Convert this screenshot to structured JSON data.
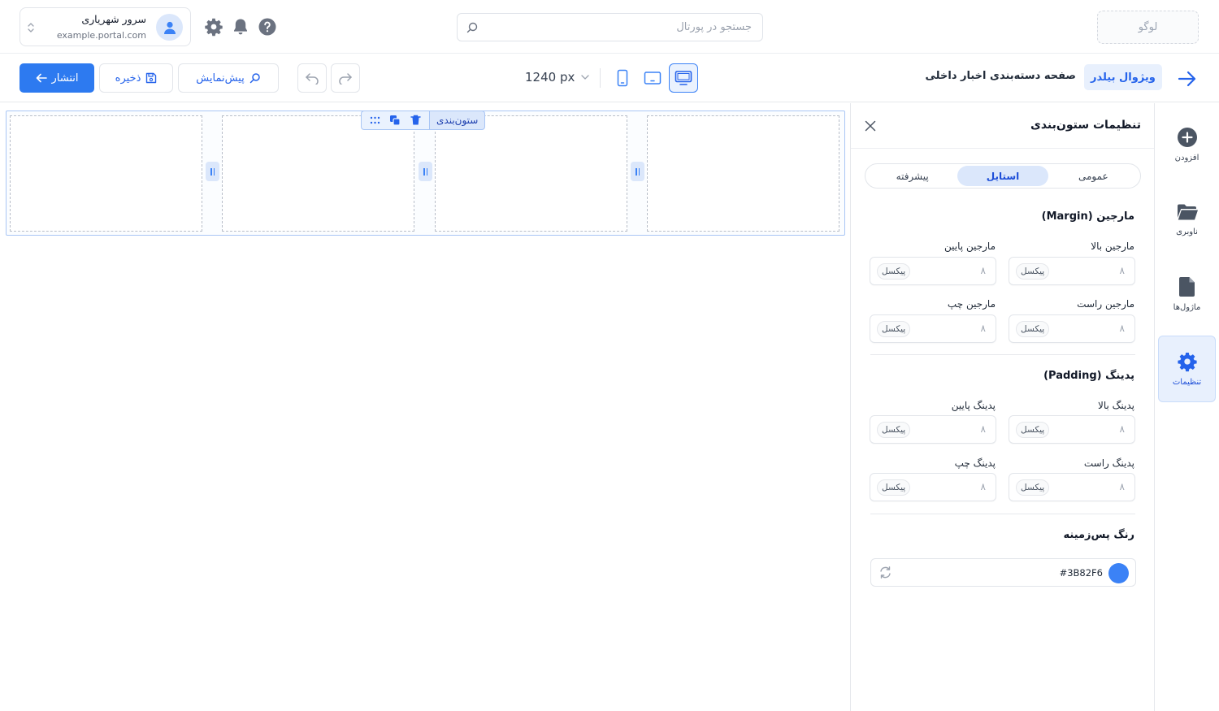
{
  "header": {
    "logo_text": "لوگو",
    "search_placeholder": "جستجو در پورتال",
    "user": {
      "name": "سرور شهریاری",
      "url": "example.portal.com"
    },
    "icons": [
      "help-icon",
      "bell-icon",
      "gear-icon"
    ]
  },
  "toolbar": {
    "crumb_app": "ویژوال بیلدر",
    "page_title": "صفحه دسته‌بندی اخبار داخلی",
    "width_value": "1240 px",
    "active_device": "desktop",
    "devices": [
      "desktop",
      "tablet",
      "mobile"
    ],
    "preview_label": "پیش‌نمایش",
    "save_label": "ذخیره",
    "publish_label": "انتشار"
  },
  "canvas": {
    "row_label": "ستون‌بندی",
    "columns_count_visible": 4
  },
  "panel": {
    "title": "تنظیمات ستون‌بندی",
    "tabs": [
      {
        "label": "عمومی",
        "active": false
      },
      {
        "label": "استایل",
        "active": true
      },
      {
        "label": "پیشرفته",
        "active": false
      }
    ],
    "margin": {
      "title": "مارجین (Margin)",
      "top_label": "مارجین بالا",
      "bottom_label": "مارجین پایین",
      "right_label": "مارجین راست",
      "left_label": "مارجین چپ",
      "top_value": "۸",
      "bottom_value": "۸",
      "right_value": "۸",
      "left_value": "۸"
    },
    "padding": {
      "title": "پدینگ (Padding)",
      "top_label": "پدینگ بالا",
      "bottom_label": "پدینگ پایین",
      "right_label": "پدینگ راست",
      "left_label": "پدینگ چپ",
      "top_value": "۸",
      "bottom_value": "۸",
      "right_value": "۸",
      "left_value": "۸"
    },
    "unit_label": "پیکسل",
    "background": {
      "title": "رنگ پس‌زمینه",
      "hex": "#3B82F6",
      "color": "#3B82F6"
    }
  },
  "rail": {
    "items": [
      {
        "label": "افزودن",
        "icon": "plus-circle-icon",
        "active": false
      },
      {
        "label": "ناوبری",
        "icon": "folder-icon",
        "active": false
      },
      {
        "label": "ماژول‌ها",
        "icon": "file-icon",
        "active": false
      },
      {
        "label": "تنظیمات",
        "icon": "gear-icon",
        "active": true
      }
    ]
  },
  "colors": {
    "accent": "#2D7AF0",
    "accent_light": "#DBE7FB",
    "border": "#E2E5EA"
  }
}
